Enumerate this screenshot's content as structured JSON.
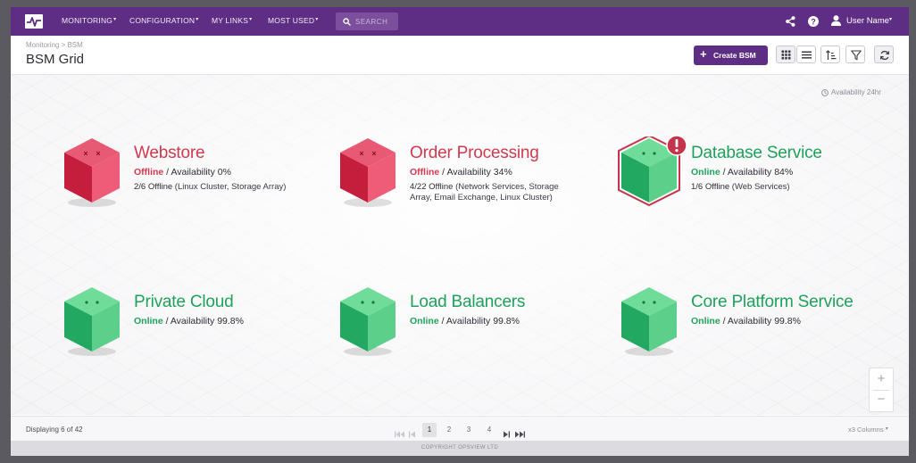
{
  "topbar": {
    "nav": [
      {
        "label": "MONITORING"
      },
      {
        "label": "CONFIGURATION"
      },
      {
        "label": "MY LINKS"
      },
      {
        "label": "MOST USED"
      }
    ],
    "search_placeholder": "SEARCH",
    "user_name": "User Name",
    "icons": [
      "share-icon",
      "help-icon",
      "user-icon"
    ]
  },
  "header": {
    "breadcrumb": "Monitoring > BSM",
    "title": "BSM Grid",
    "create_label": "Create BSM",
    "view_buttons": [
      "grid-view-icon",
      "list-view-icon",
      "sort-icon",
      "filter-icon",
      "refresh-icon"
    ]
  },
  "availability_note": "Availability 24hr",
  "colors": {
    "brand": "#5e2d84",
    "offline": "#d0394e",
    "online": "#1ea25a"
  },
  "cards": [
    {
      "title": "Webstore",
      "state": "Offline",
      "availability": "Availability 0%",
      "detail_count": "2/6 Offline",
      "detail_text": "(Linux Cluster, Storage Array)",
      "status": "offline",
      "alert": false
    },
    {
      "title": "Order Processing",
      "state": "Offline",
      "availability": "Availability 34%",
      "detail_count": "4/22 Offline",
      "detail_text": "(Network Services, Storage Array, Email Exchange, Linux Cluster)",
      "status": "offline",
      "alert": false
    },
    {
      "title": "Database Service",
      "state": "Online",
      "availability": "Availability 84%",
      "detail_count": "1/6 Offline",
      "detail_text": "(Web Services)",
      "status": "online",
      "alert": true
    },
    {
      "title": "Private Cloud",
      "state": "Online",
      "availability": "Availability 99.8%",
      "detail_count": "",
      "detail_text": "",
      "status": "online",
      "alert": false
    },
    {
      "title": "Load Balancers",
      "state": "Online",
      "availability": "Availability 99.8%",
      "detail_count": "",
      "detail_text": "",
      "status": "online",
      "alert": false
    },
    {
      "title": "Core Platform Service",
      "state": "Online",
      "availability": "Availability 99.8%",
      "detail_count": "",
      "detail_text": "",
      "status": "online",
      "alert": false
    }
  ],
  "zoom": {
    "in": "+",
    "out": "−"
  },
  "footer": {
    "displaying": "Displaying 6 of 42",
    "pages": [
      "1",
      "2",
      "3",
      "4"
    ],
    "current_page": "1",
    "columns": "x3 Columns",
    "copyright": "COPYRIGHT OPSVIEW LTD"
  }
}
